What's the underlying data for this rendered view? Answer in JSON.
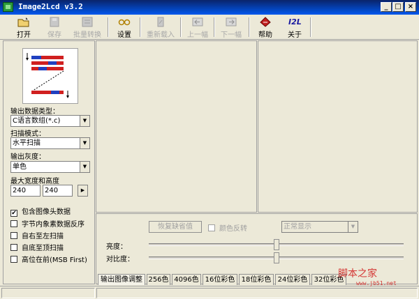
{
  "window": {
    "title": "Image2Lcd v3.2"
  },
  "toolbar": {
    "open": "打开",
    "save": "保存",
    "batch": "批量转换",
    "settings": "设置",
    "reload": "重新载入",
    "prev": "上一幅",
    "next": "下一幅",
    "help": "帮助",
    "about": "关于",
    "about_icon_text": "I2L"
  },
  "left": {
    "output_type_label": "输出数据类型：",
    "output_type_value": "C语言数组(*.c)",
    "scan_mode_label": "扫描模式：",
    "scan_mode_value": "水平扫描",
    "gray_label": "输出灰度：",
    "gray_value": "单色",
    "size_label": "最大宽度和高度",
    "width": "240",
    "height": "240",
    "options": [
      {
        "label": "包含图像头数据",
        "checked": true
      },
      {
        "label": "字节内象素数据反序",
        "checked": false
      },
      {
        "label": "自右至左扫描",
        "checked": false
      },
      {
        "label": "自底至顶扫描",
        "checked": false
      },
      {
        "label": "高位在前(MSB First)",
        "checked": false
      }
    ]
  },
  "bottom": {
    "restore_default": "恢复缺省值",
    "invert_color": "颜色反转",
    "display_mode": "正常显示",
    "brightness_label": "亮度：",
    "contrast_label": "对比度：",
    "brightness_level": 0.5,
    "contrast_level": 0.5,
    "tabs": [
      "输出图像调整",
      "256色",
      "4096色",
      "16位彩色",
      "18位彩色",
      "24位彩色",
      "32位彩色"
    ]
  },
  "watermark": {
    "text": "脚本之家",
    "url": "www.jb51.net"
  },
  "colors": {
    "titlebar": "#0a246a",
    "accent_red": "#d01818"
  }
}
